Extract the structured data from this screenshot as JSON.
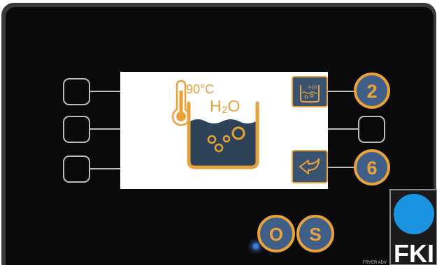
{
  "screen": {
    "temperature": "90°C",
    "liquid_label": "H₂O"
  },
  "callouts": {
    "top_right": "2",
    "bottom_right": "6",
    "bottom_o": "O",
    "bottom_s": "S"
  },
  "softkey_icons": {
    "top_right": "water-bath-icon",
    "bottom_right": "back-arrow-icon"
  },
  "icon_labels": {
    "mini_h2o": "H2O"
  },
  "brand": {
    "logo_text": "FKI",
    "model": "FRYER ADV"
  },
  "colors": {
    "panel": "#0a0a0a",
    "bezel": "#262626",
    "accent": "#e9a23a",
    "callout_fill": "#3f5f88",
    "icon_button": "#3a5371",
    "logo_blue": "#1a94e0",
    "screen": "#ffffff",
    "liquid": "#2f4358"
  }
}
